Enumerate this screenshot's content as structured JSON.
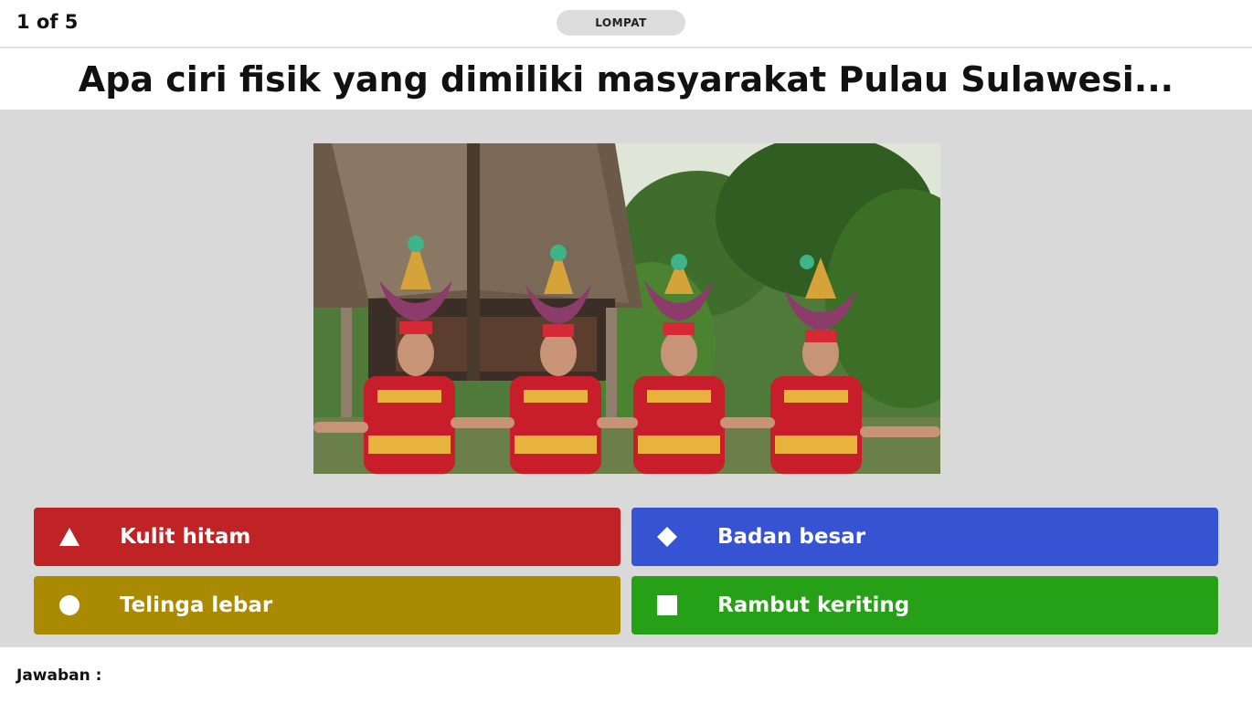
{
  "header": {
    "progress": "1 of 5",
    "skip_label": "LOMPAT"
  },
  "question": {
    "text": "Apa ciri fisik yang dimiliki masyarakat Pulau Sulawesi..."
  },
  "image": {
    "description_icon": "photo-toraja-dancers"
  },
  "answers": [
    {
      "label": "Kulit hitam",
      "shape": "triangle-icon",
      "color": "#c02326"
    },
    {
      "label": "Badan besar",
      "shape": "diamond-icon",
      "color": "#3653d4"
    },
    {
      "label": "Telinga lebar",
      "shape": "circle-icon",
      "color": "#a98a01"
    },
    {
      "label": "Rambut keriting",
      "shape": "square-icon",
      "color": "#26a017"
    }
  ],
  "footer": {
    "answer_label": "Jawaban :"
  }
}
